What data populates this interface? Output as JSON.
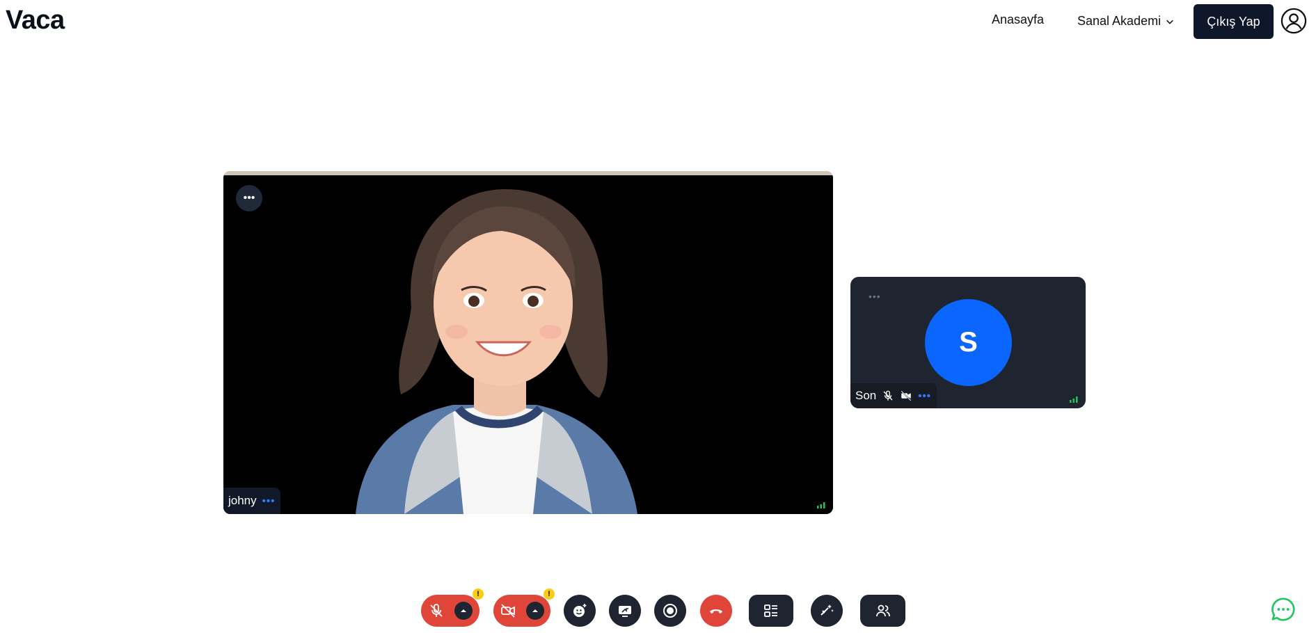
{
  "header": {
    "brand": "Vaca",
    "nav_home": "Anasayfa",
    "nav_academy": "Sanal Akademi",
    "logout_label": "Çıkış Yap"
  },
  "main_tile": {
    "participant_name": "johny",
    "menu_glyph": "•••",
    "name_menu_glyph": "•••",
    "icons": [
      "more-options-icon",
      "signal-strength-icon"
    ]
  },
  "side_tile": {
    "participant_name": "Son",
    "avatar_initial": "S",
    "menu_glyph": "•••",
    "name_menu_glyph": "•••",
    "icons": [
      "mic-off-icon",
      "camera-off-icon",
      "signal-strength-icon"
    ]
  },
  "controls": {
    "warning_glyph": "!",
    "buttons": [
      "mic-toggle",
      "camera-toggle",
      "reactions",
      "screen-share",
      "record",
      "leave-call",
      "layout",
      "effects",
      "participants"
    ]
  },
  "colors": {
    "brand_dark": "#0f172a",
    "danger": "#e0453a",
    "tile_dark": "#1e2530",
    "avatar_blue": "#0a66ff",
    "warning": "#facc15",
    "chat_green": "#22c55e"
  }
}
